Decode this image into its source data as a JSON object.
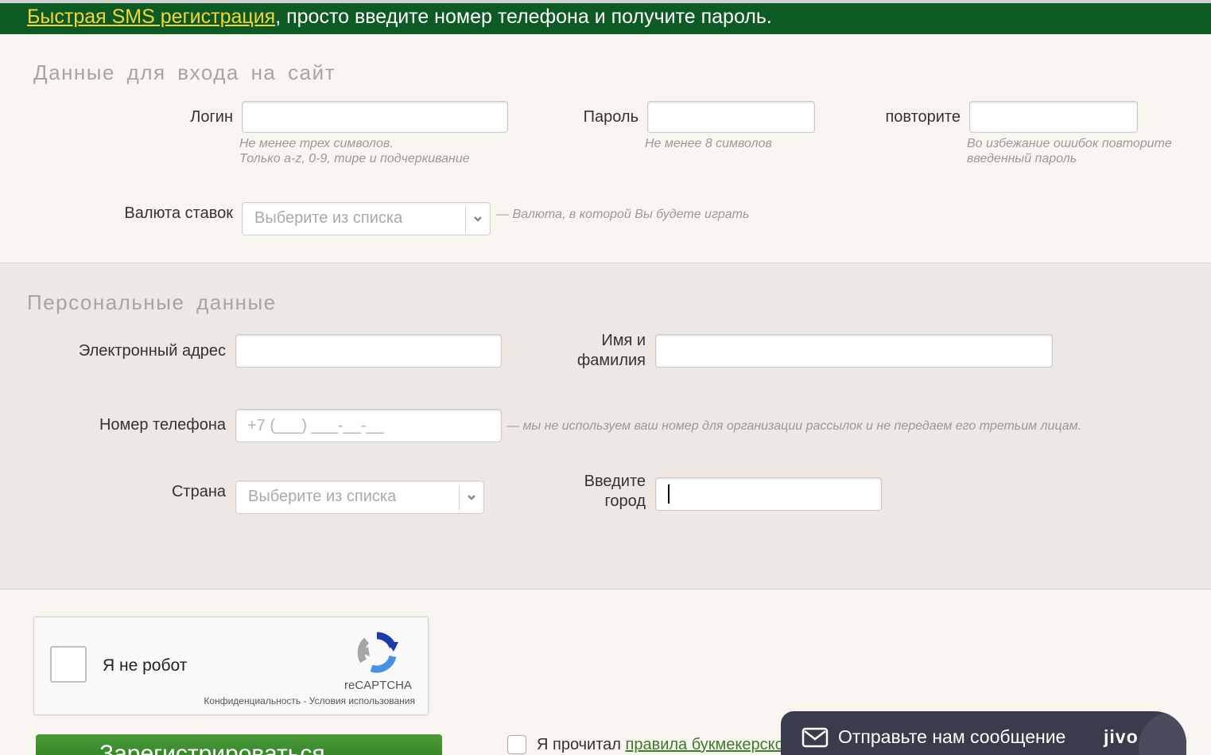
{
  "banner": {
    "link": "Быстрая SMS регистрация",
    "text": ", просто введите номер телефона и получите пароль."
  },
  "login_section": {
    "title": "Данные для входа на сайт",
    "login_label": "Логин",
    "login_hint_1": "Не менее трех символов.",
    "login_hint_2": "Только a-z, 0-9, тире и подчеркивание",
    "password_label": "Пароль",
    "password_hint": "Не менее 8 символов",
    "repeat_label": "повторите",
    "repeat_hint_1": "Во избежание ошибок повторите",
    "repeat_hint_2": "введенный пароль",
    "currency_label": "Валюта ставок",
    "currency_select": "Выберите из списка",
    "currency_hint": "— Валюта, в которой Вы будете играть"
  },
  "personal_section": {
    "title": "Персональные данные",
    "email_label": "Электронный адрес",
    "name_label_1": "Имя и",
    "name_label_2": "фамилия",
    "phone_label": "Номер телефона",
    "phone_placeholder": "+7 (___) ___-__-__",
    "phone_hint": "— мы не используем ваш номер для организации рассылок и не передаем его третьим лицам.",
    "country_label": "Страна",
    "country_select": "Выберите из списка",
    "city_label_1": "Введите",
    "city_label_2": "город"
  },
  "captcha": {
    "label": "Я не робот",
    "brand": "reCAPTCHA",
    "terms": "Конфиденциальность - Условия использования"
  },
  "register": {
    "button": "Зарегистрироваться",
    "rules_prefix": "Я прочитал ",
    "rules_link": "правила букмекерско"
  },
  "chat": {
    "text": "Отправьте нам сообщение",
    "logo": "jivo"
  },
  "colors": {
    "banner_bg": "#0d5a25",
    "banner_link": "#f2d43b",
    "register_green": "#3a8a2c",
    "chat_bg": "#3a3c4e"
  }
}
